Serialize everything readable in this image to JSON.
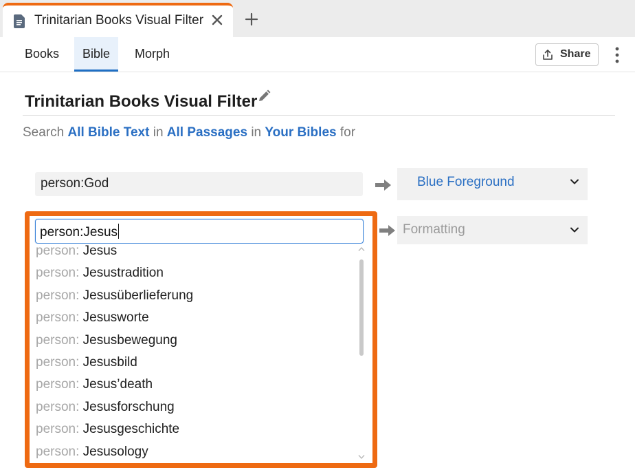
{
  "document_tab": {
    "title": "Trinitarian Books Visual Filter",
    "icon": "document-icon"
  },
  "toolbar": {
    "tabs": [
      {
        "label": "Books"
      },
      {
        "label": "Bible"
      },
      {
        "label": "Morph"
      }
    ],
    "active_tab": "Bible",
    "share_label": "Share"
  },
  "panel": {
    "title": "Trinitarian Books Visual Filter",
    "search_line": {
      "prefix": "Search",
      "scope": "All Bible Text",
      "in1": "in",
      "range": "All Passages",
      "in2": "in",
      "source": "Your Bibles",
      "suffix": "for"
    }
  },
  "rows": [
    {
      "query": "person:God",
      "format": "Blue Foreground"
    },
    {
      "query": "person:Jesus",
      "format": "Formatting"
    }
  ],
  "autocomplete": {
    "prefix": "person:",
    "items": [
      "Jesus",
      "Jesustradition",
      "Jesusüberlieferung",
      "Jesusworte",
      "Jesusbewegung",
      "Jesusbild",
      "Jesus’death",
      "Jesusforschung",
      "Jesusgeschichte",
      "Jesusology"
    ]
  },
  "colors": {
    "accent_orange": "#ee6a12",
    "link_blue": "#2a6fc3",
    "active_tab_bg": "#e8f1fb"
  }
}
